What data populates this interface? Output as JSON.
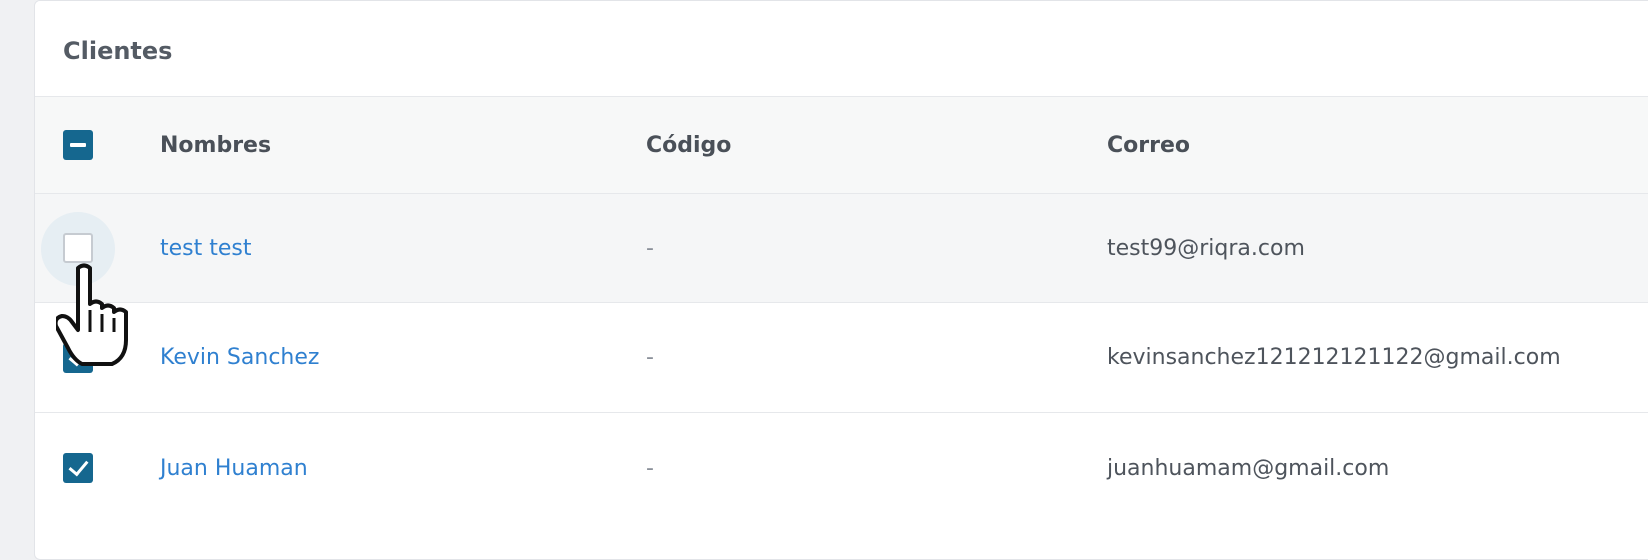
{
  "card": {
    "title": "Clientes"
  },
  "table": {
    "headers": {
      "name": "Nombres",
      "code": "Código",
      "email": "Correo"
    },
    "select_all_state": "partial",
    "rows": [
      {
        "name": "test test",
        "code": "-",
        "email": "test99@riqra.com",
        "checked": false
      },
      {
        "name": "Kevin Sanchez",
        "code": "-",
        "email": "kevinsanchez121212121122@gmail.com",
        "checked": true
      },
      {
        "name": "Juan Huaman",
        "code": "-",
        "email": "juanhuamam@gmail.com",
        "checked": true
      }
    ]
  },
  "icons": {
    "cursor": "hand-pointer-icon"
  },
  "colors": {
    "accent": "#15678f",
    "link": "#2f80d0",
    "text": "#4e545c"
  }
}
